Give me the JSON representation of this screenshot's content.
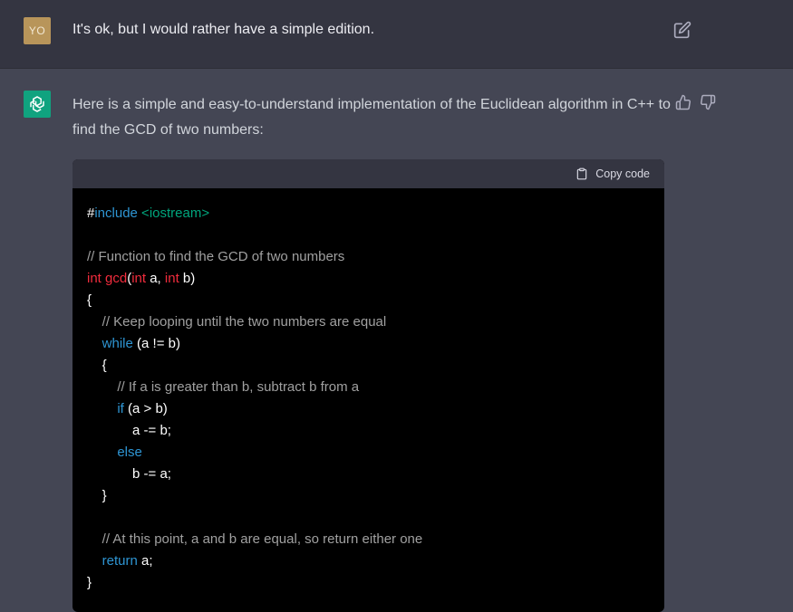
{
  "user_message": {
    "avatar_initials": "YO",
    "text": "It's ok, but I would rather have a simple edition."
  },
  "assistant_message": {
    "text": "Here is a simple and easy-to-understand implementation of the Euclidean algorithm in C++ to find the GCD of two numbers:",
    "code_block": {
      "copy_label": "Copy code",
      "lines": {
        "l1_hash": "#",
        "l1_include": "include",
        "l1_header": " <iostream>",
        "l3": "// Function to find the GCD of two numbers",
        "l4_int1": "int",
        "l4_gcd": " gcd",
        "l4_paren": "(",
        "l4_int2": "int",
        "l4_a": " a, ",
        "l4_int3": "int",
        "l4_b": " b)",
        "l5": "{",
        "l6": "    // Keep looping until the two numbers are equal",
        "l7_indent": "    ",
        "l7_kw": "while",
        "l7_rest": " (a != b)",
        "l8": "    {",
        "l9": "        // If a is greater than b, subtract b from a",
        "l10_indent": "        ",
        "l10_kw": "if",
        "l10_rest": " (a > b)",
        "l11": "            a -= b;",
        "l12_indent": "        ",
        "l12_kw": "else",
        "l13": "            b -= a;",
        "l14": "    }",
        "l16": "    // At this point, a and b are equal, so return either one",
        "l17_indent": "    ",
        "l17_kw": "return",
        "l17_rest": " a;",
        "l18": "}"
      }
    }
  },
  "colors": {
    "user_row_bg": "#343541",
    "assistant_row_bg": "#444654",
    "gpt_avatar": "#10a37f",
    "user_avatar": "#b8955a"
  },
  "icons": {
    "edit": "edit-icon",
    "thumbs_up": "thumbs-up-icon",
    "thumbs_down": "thumbs-down-icon",
    "clipboard": "clipboard-icon",
    "openai": "openai-logo-icon"
  }
}
